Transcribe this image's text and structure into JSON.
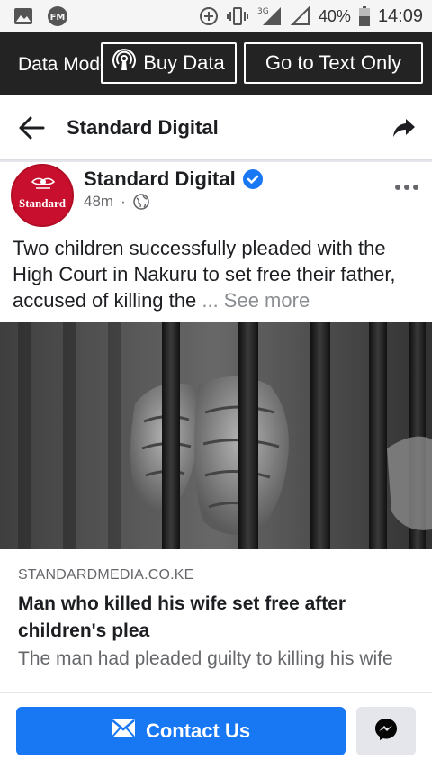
{
  "status_bar": {
    "icons": [
      "image-icon",
      "fm-radio-icon",
      "data-saver-icon",
      "vibrate-icon",
      "signal-3g-icon",
      "signal-empty-icon",
      "battery-icon"
    ],
    "network": "3G",
    "battery": "40%",
    "time": "14:09"
  },
  "data_banner": {
    "label": "Data Mode",
    "buy_data_label": "Buy Data",
    "text_only_label": "Go to Text Only"
  },
  "header": {
    "title": "Standard Digital"
  },
  "post": {
    "page_name": "Standard Digital",
    "time_ago": "48m",
    "separator": "·",
    "avatar_wordmark": "Standard",
    "text": "Two children successfully pleaded with the High Court in Nakuru to set free their father, accused of killing the ",
    "see_more": "... See more",
    "image_description_icon": "prison-bars-hands-image"
  },
  "link_preview": {
    "domain": "STANDARDMEDIA.CO.KE",
    "title": "Man who killed his wife set free after children's plea",
    "description": "The man had pleaded guilty to killing his wife"
  },
  "actions": {
    "contact_label": "Contact Us",
    "contact_color": "#1877f2"
  }
}
